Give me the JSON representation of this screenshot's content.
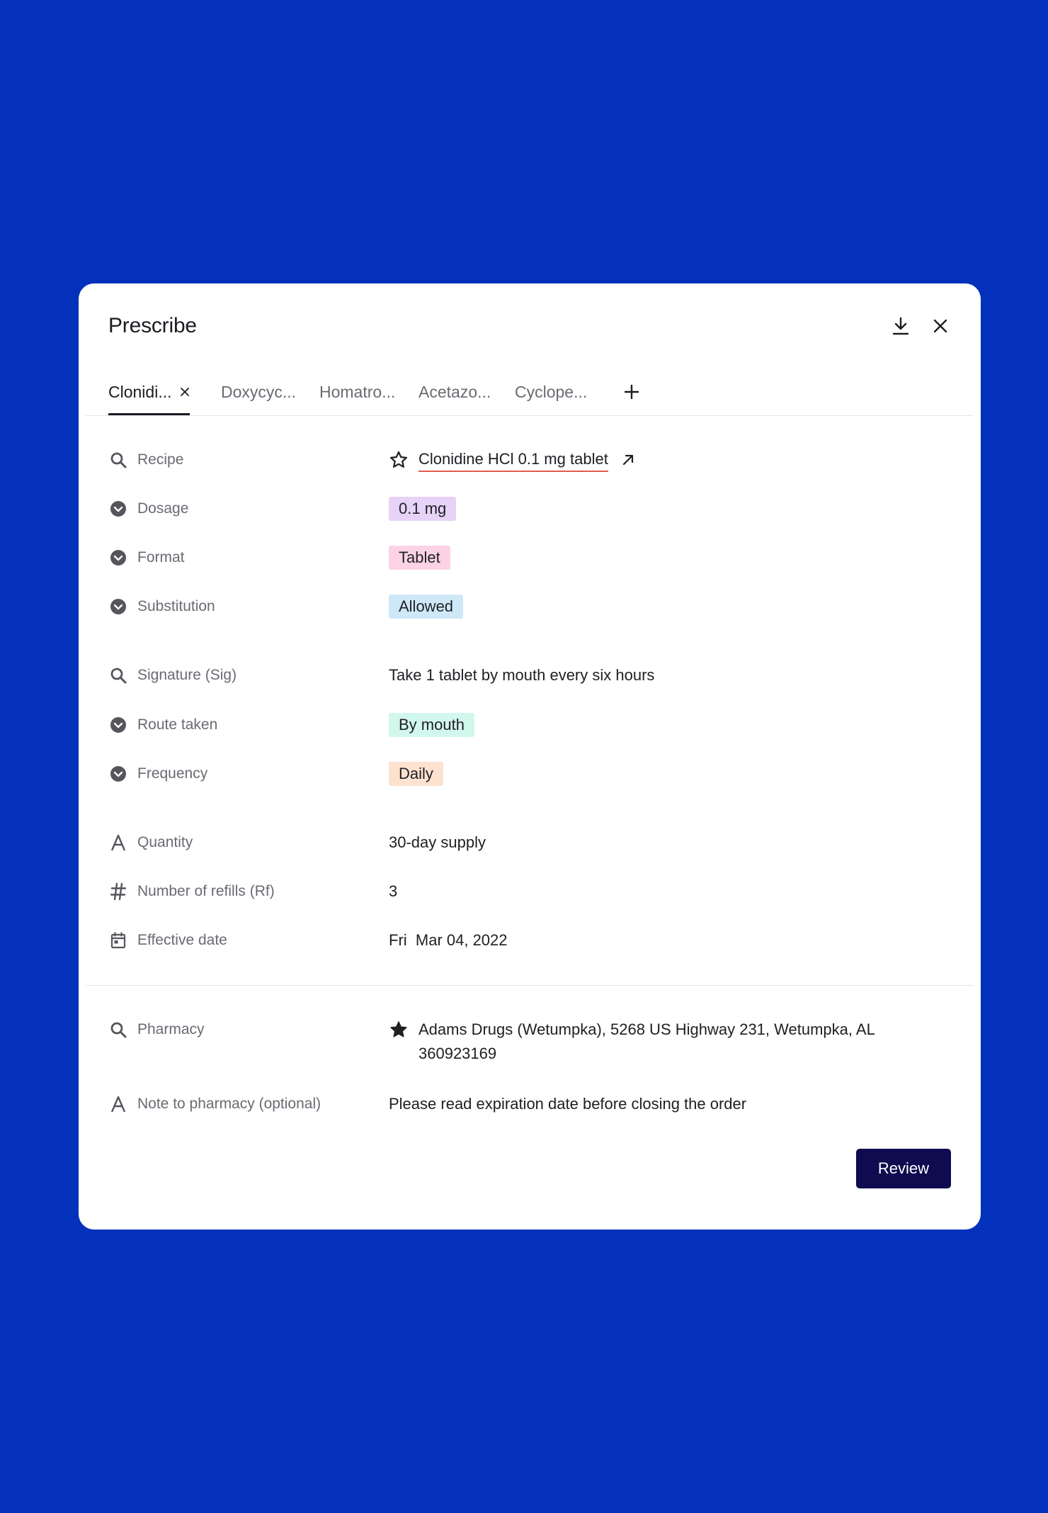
{
  "modal": {
    "title": "Prescribe",
    "tabs": [
      {
        "label": "Clonidi...",
        "active": true
      },
      {
        "label": "Doxycyc..."
      },
      {
        "label": "Homatro..."
      },
      {
        "label": "Acetazo..."
      },
      {
        "label": "Cyclope..."
      }
    ],
    "fields": {
      "recipe": {
        "label": "Recipe",
        "value": "Clonidine HCl 0.1 mg tablet",
        "icon": "search-icon"
      },
      "dosage": {
        "label": "Dosage",
        "value": "0.1 mg",
        "icon": "chevron-down-circle-icon",
        "color": "#e6d3f7"
      },
      "format": {
        "label": "Format",
        "value": "Tablet",
        "icon": "chevron-down-circle-icon",
        "color": "#fbd3e4"
      },
      "substitution": {
        "label": "Substitution",
        "value": "Allowed",
        "icon": "chevron-down-circle-icon",
        "color": "#cfe8f8"
      },
      "signature": {
        "label": "Signature (Sig)",
        "value": "Take 1 tablet by mouth every six hours",
        "icon": "search-icon"
      },
      "route": {
        "label": "Route taken",
        "value": "By mouth",
        "icon": "chevron-down-circle-icon",
        "color": "#d2f7ec"
      },
      "frequency": {
        "label": "Frequency",
        "value": "Daily",
        "icon": "chevron-down-circle-icon",
        "color": "#fde2cf"
      },
      "quantity": {
        "label": "Quantity",
        "value": "30-day supply",
        "icon": "text-a-icon"
      },
      "refills": {
        "label": "Number of refills (Rf)",
        "value": "3",
        "icon": "hash-icon"
      },
      "effective_date": {
        "label": "Effective date",
        "value": "Fri  Mar 04, 2022",
        "icon": "calendar-icon"
      },
      "pharmacy": {
        "label": "Pharmacy",
        "value": "Adams Drugs (Wetumpka), 5268 US Highway 231, Wetumpka, AL 360923169",
        "icon": "search-icon"
      },
      "note": {
        "label": "Note to pharmacy (optional)",
        "value": "Please read expiration date before closing the order",
        "icon": "text-a-icon"
      }
    },
    "review_label": "Review"
  },
  "colors": {
    "background": "#0331bc",
    "review_button": "#0e0b50",
    "recipe_underline": "#e35b4c"
  }
}
